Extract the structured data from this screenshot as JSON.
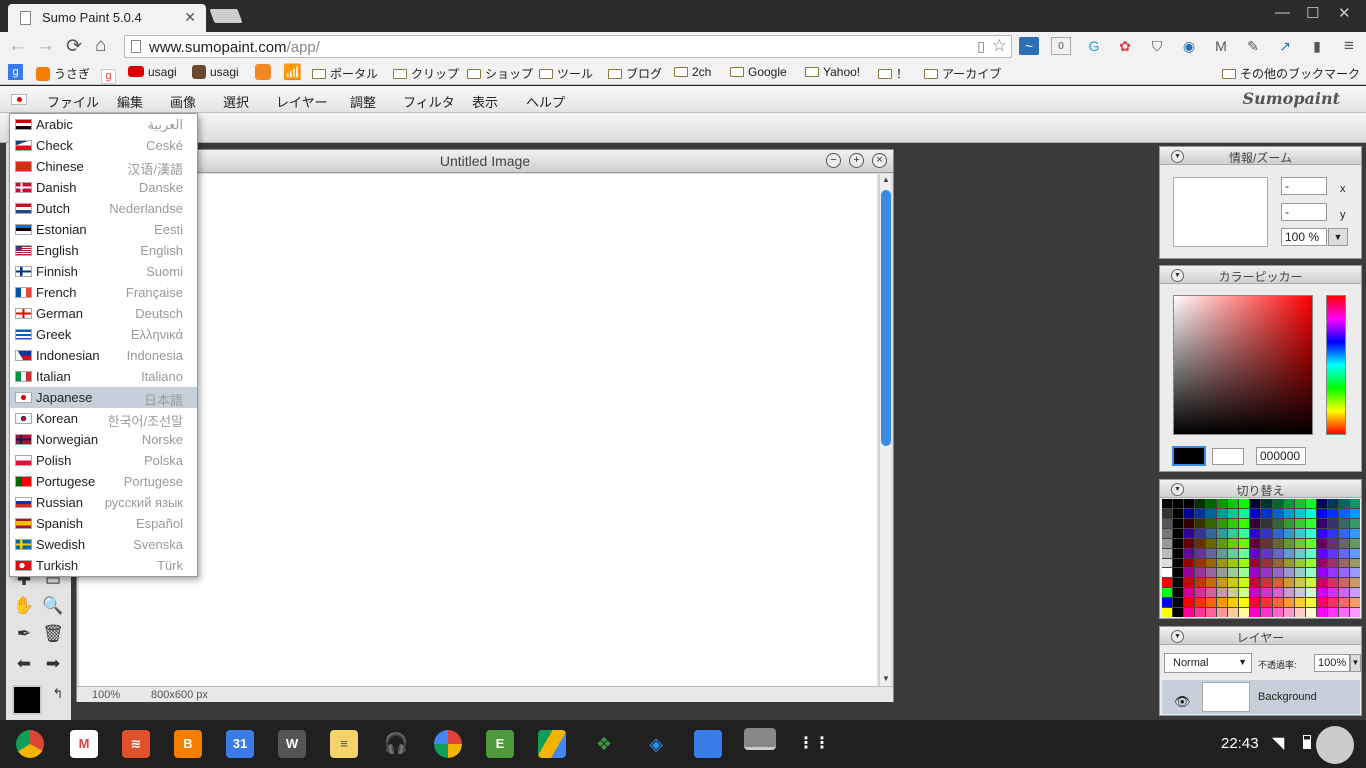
{
  "browser": {
    "tab_title": "Sumo Paint 5.0.4",
    "tab_close": "✕",
    "url_host": "www.sumopaint.com",
    "url_path": "/app/",
    "ext_badge": "0",
    "win_min": "—",
    "win_max": "☐",
    "win_close": "✕"
  },
  "bookmarks": {
    "left": [
      {
        "label": "うさぎ",
        "icon": "blogger-icon"
      },
      {
        "label": "usagi",
        "icon": "youtube-icon"
      },
      {
        "label": "usagi",
        "icon": "instagram-icon"
      },
      {
        "label": "ポータル",
        "icon": "folder-icon"
      },
      {
        "label": "クリップ",
        "icon": "folder-icon"
      },
      {
        "label": "ショップ",
        "icon": "folder-icon"
      },
      {
        "label": "ツール",
        "icon": "folder-icon"
      },
      {
        "label": "ブログ",
        "icon": "folder-icon"
      },
      {
        "label": "2ch",
        "icon": "folder-icon"
      },
      {
        "label": "Google",
        "icon": "folder-icon"
      },
      {
        "label": "Yahoo!",
        "icon": "folder-icon"
      },
      {
        "label": "！",
        "icon": "folder-icon"
      },
      {
        "label": "アーカイブ",
        "icon": "folder-icon"
      }
    ],
    "other": "その他のブックマーク"
  },
  "menubar": {
    "items": [
      "ファイル",
      "編集",
      "画像",
      "選択",
      "レイヤー",
      "調整",
      "フィルタ",
      "表示",
      "ヘルプ"
    ],
    "brand": "Sumopaint"
  },
  "languages": [
    {
      "en": "Arabic",
      "native": "العربية",
      "flag": "eg"
    },
    {
      "en": "Check",
      "native": "Ceské",
      "flag": "cz"
    },
    {
      "en": "Chinese",
      "native": "汉语/漢語",
      "flag": "cn"
    },
    {
      "en": "Danish",
      "native": "Danske",
      "flag": "dk"
    },
    {
      "en": "Dutch",
      "native": "Nederlandse",
      "flag": "nl"
    },
    {
      "en": "Estonian",
      "native": "Eesti",
      "flag": "ee"
    },
    {
      "en": "English",
      "native": "English",
      "flag": "us"
    },
    {
      "en": "Finnish",
      "native": "Suomi",
      "flag": "fi"
    },
    {
      "en": "French",
      "native": "Française",
      "flag": "fr"
    },
    {
      "en": "German",
      "native": "Deutsch",
      "flag": "ge"
    },
    {
      "en": "Greek",
      "native": "Ελληνικά",
      "flag": "gr"
    },
    {
      "en": "Indonesian",
      "native": "Indonesia",
      "flag": "ph"
    },
    {
      "en": "Italian",
      "native": "Italiano",
      "flag": "it"
    },
    {
      "en": "Japanese",
      "native": "日本語",
      "flag": "jp",
      "selected": true
    },
    {
      "en": "Korean",
      "native": "한국어/조선말",
      "flag": "kr"
    },
    {
      "en": "Norwegian",
      "native": "Norske",
      "flag": "no"
    },
    {
      "en": "Polish",
      "native": "Polska",
      "flag": "pl"
    },
    {
      "en": "Portugese",
      "native": "Portugese",
      "flag": "pt"
    },
    {
      "en": "Russian",
      "native": "русский язык",
      "flag": "ru"
    },
    {
      "en": "Spanish",
      "native": "Español",
      "flag": "es"
    },
    {
      "en": "Swedish",
      "native": "Svenska",
      "flag": "se"
    },
    {
      "en": "Turkish",
      "native": "Türk",
      "flag": "tr"
    }
  ],
  "document": {
    "title": "Untitled Image",
    "zoom": "100%",
    "size": "800x600 px"
  },
  "panels": {
    "info": {
      "title": "情報/ズーム",
      "x_value": "-",
      "y_value": "-",
      "x_label": "x",
      "y_label": "y",
      "zoom": "100 %"
    },
    "color": {
      "title": "カラーピッカー",
      "hex": "000000",
      "fg": "#000000",
      "bg": "#ffffff"
    },
    "swatches": {
      "title": "切り替え"
    },
    "layers": {
      "title": "レイヤー",
      "blend": "Normal",
      "opacity_label": "不透過率:",
      "opacity": "100%",
      "layer_name": "Background"
    }
  },
  "taskbar": {
    "clock": "22:43",
    "calendar_day": "31",
    "writer_letter": "W"
  }
}
